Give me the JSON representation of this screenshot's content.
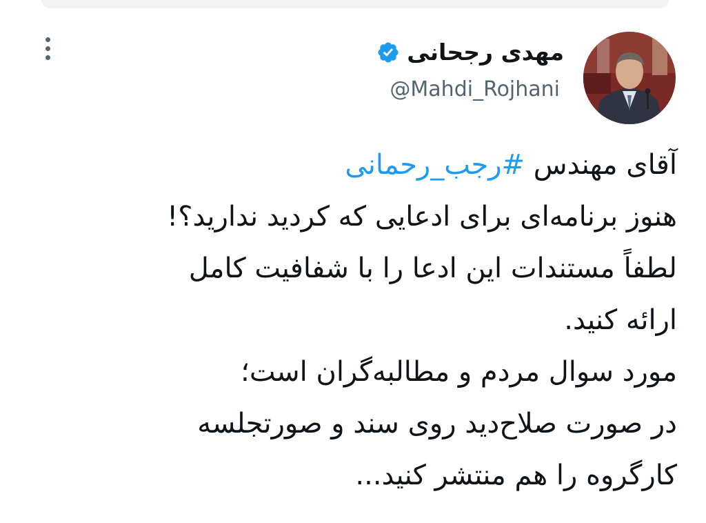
{
  "author": {
    "name": "مهدی رجحانی",
    "handle": "@Mahdi_Rojhani",
    "verified": true,
    "avatar": "profile-photo"
  },
  "tweet": {
    "lines": [
      {
        "text": "آقای مهندس ",
        "hashtag": "#رجب_رحمانی"
      },
      {
        "text": "هنوز برنامه‌ای برای ادعایی که کردید ندارید؟!"
      },
      {
        "text": "لطفاً مستندات این ادعا را با شفافیت کامل"
      },
      {
        "text": "ارائه کنید."
      },
      {
        "text": "مورد سوال مردم و مطالبه‌گران است؛"
      },
      {
        "text": "در صورت صلاح‌دید روی سند و صورتجلسه"
      },
      {
        "text": "کارگروه را هم منتشر کنید..."
      }
    ]
  },
  "icons": {
    "more": "more-options-icon",
    "verified": "verified-badge-icon"
  },
  "colors": {
    "hashtag": "#1d9bf0",
    "verified": "#1d9bf0",
    "text": "#0f1419",
    "secondary": "#536471"
  }
}
